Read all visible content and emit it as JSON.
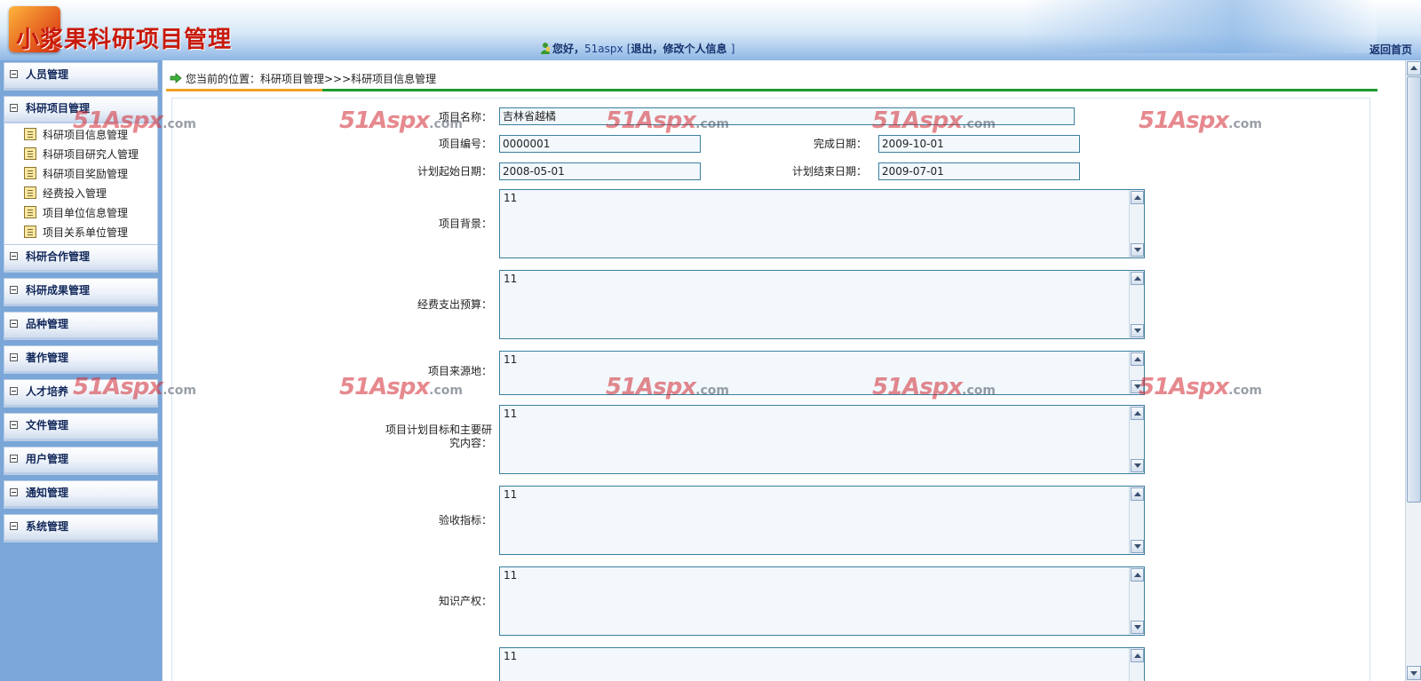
{
  "header": {
    "title": "小浆果科研项目管理",
    "greeting": "您好，",
    "username": "51aspx",
    "bracket_open": "[",
    "logout": "退出",
    "separator": "，",
    "edit_profile": "修改个人信息",
    "bracket_close": "]",
    "home": "返回首页"
  },
  "sidebar": {
    "groups": [
      {
        "label": "人员管理"
      },
      {
        "label": "科研项目管理",
        "items": [
          {
            "label": "科研项目信息管理"
          },
          {
            "label": "科研项目研究人管理"
          },
          {
            "label": "科研项目奖励管理"
          },
          {
            "label": "经费投入管理"
          },
          {
            "label": "项目单位信息管理"
          },
          {
            "label": "项目关系单位管理"
          }
        ]
      },
      {
        "label": "科研合作管理"
      },
      {
        "label": "科研成果管理"
      },
      {
        "label": "品种管理"
      },
      {
        "label": "著作管理"
      },
      {
        "label": "人才培养"
      },
      {
        "label": "文件管理"
      },
      {
        "label": "用户管理"
      },
      {
        "label": "通知管理"
      },
      {
        "label": "系统管理"
      }
    ]
  },
  "breadcrumb": "您当前的位置：科研项目管理>>>科研项目信息管理",
  "form": {
    "project_name": {
      "label": "项目名称：",
      "value": "吉林省越橘"
    },
    "project_no": {
      "label": "项目编号：",
      "value": "0000001"
    },
    "finish_date": {
      "label": "完成日期：",
      "value": "2009-10-01"
    },
    "plan_start": {
      "label": "计划起始日期：",
      "value": "2008-05-01"
    },
    "plan_end": {
      "label": "计划结束日期：",
      "value": "2009-07-01"
    },
    "background": {
      "label": "项目背景：",
      "value": "11"
    },
    "budget": {
      "label": "经费支出预算：",
      "value": "11"
    },
    "source": {
      "label": "项目来源地：",
      "value": "11"
    },
    "goals": {
      "label": "项目计划目标和主要研究内容：",
      "value": "11"
    },
    "acceptance": {
      "label": "验收指标：",
      "value": "11"
    },
    "ip": {
      "label": "知识产权：",
      "value": "11"
    },
    "last": {
      "value": "11"
    }
  },
  "watermark": {
    "brand": "51Aspx",
    "suffix": ".com"
  },
  "colors": {
    "accent_orange": "#f0a020",
    "accent_green": "#1d9a2c",
    "sidebar_bg": "#7aa6d8",
    "title_red": "#c81a0c"
  }
}
